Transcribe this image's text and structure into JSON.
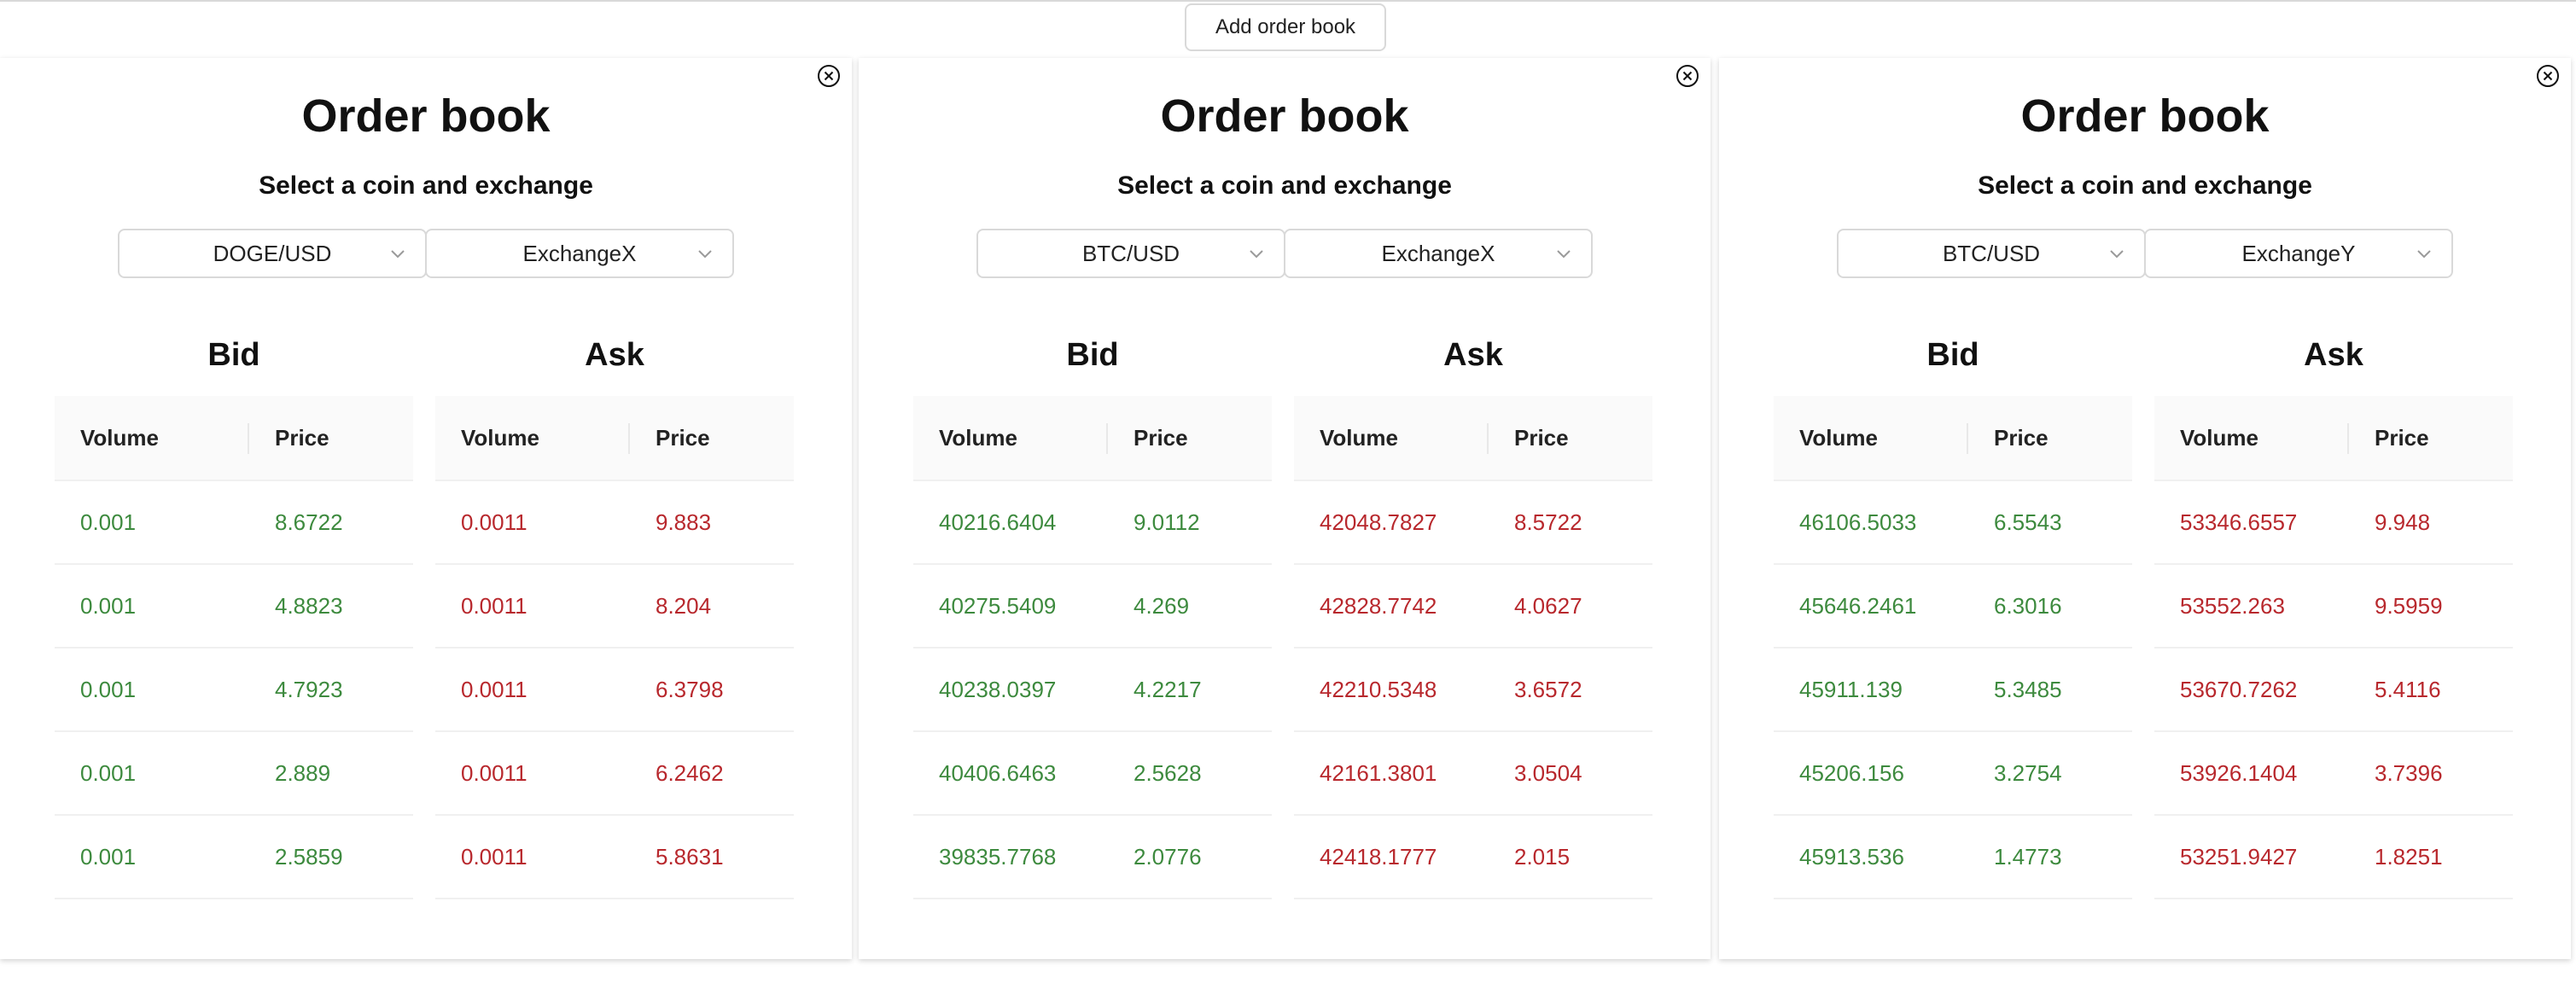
{
  "toolbar": {
    "add_label": "Add order book"
  },
  "colors": {
    "bid": "#3d8a3e",
    "ask": "#b8282d",
    "border": "#d9d9d9",
    "header_bg": "#fafafa"
  },
  "panels": [
    {
      "title": "Order book",
      "subtitle": "Select a coin and exchange",
      "pair": "DOGE/USD",
      "exchange": "ExchangeX",
      "bid": {
        "title": "Bid",
        "headers": [
          "Volume",
          "Price"
        ],
        "rows": [
          [
            "0.001",
            "8.6722"
          ],
          [
            "0.001",
            "4.8823"
          ],
          [
            "0.001",
            "4.7923"
          ],
          [
            "0.001",
            "2.889"
          ],
          [
            "0.001",
            "2.5859"
          ]
        ]
      },
      "ask": {
        "title": "Ask",
        "headers": [
          "Volume",
          "Price"
        ],
        "rows": [
          [
            "0.0011",
            "9.883"
          ],
          [
            "0.0011",
            "8.204"
          ],
          [
            "0.0011",
            "6.3798"
          ],
          [
            "0.0011",
            "6.2462"
          ],
          [
            "0.0011",
            "5.8631"
          ]
        ]
      }
    },
    {
      "title": "Order book",
      "subtitle": "Select a coin and exchange",
      "pair": "BTC/USD",
      "exchange": "ExchangeX",
      "bid": {
        "title": "Bid",
        "headers": [
          "Volume",
          "Price"
        ],
        "rows": [
          [
            "40216.6404",
            "9.0112"
          ],
          [
            "40275.5409",
            "4.269"
          ],
          [
            "40238.0397",
            "4.2217"
          ],
          [
            "40406.6463",
            "2.5628"
          ],
          [
            "39835.7768",
            "2.0776"
          ]
        ]
      },
      "ask": {
        "title": "Ask",
        "headers": [
          "Volume",
          "Price"
        ],
        "rows": [
          [
            "42048.7827",
            "8.5722"
          ],
          [
            "42828.7742",
            "4.0627"
          ],
          [
            "42210.5348",
            "3.6572"
          ],
          [
            "42161.3801",
            "3.0504"
          ],
          [
            "42418.1777",
            "2.015"
          ]
        ]
      }
    },
    {
      "title": "Order book",
      "subtitle": "Select a coin and exchange",
      "pair": "BTC/USD",
      "exchange": "ExchangeY",
      "bid": {
        "title": "Bid",
        "headers": [
          "Volume",
          "Price"
        ],
        "rows": [
          [
            "46106.5033",
            "6.5543"
          ],
          [
            "45646.2461",
            "6.3016"
          ],
          [
            "45911.139",
            "5.3485"
          ],
          [
            "45206.156",
            "3.2754"
          ],
          [
            "45913.536",
            "1.4773"
          ]
        ]
      },
      "ask": {
        "title": "Ask",
        "headers": [
          "Volume",
          "Price"
        ],
        "rows": [
          [
            "53346.6557",
            "9.948"
          ],
          [
            "53552.263",
            "9.5959"
          ],
          [
            "53670.7262",
            "5.4116"
          ],
          [
            "53926.1404",
            "3.7396"
          ],
          [
            "53251.9427",
            "1.8251"
          ]
        ]
      }
    }
  ]
}
